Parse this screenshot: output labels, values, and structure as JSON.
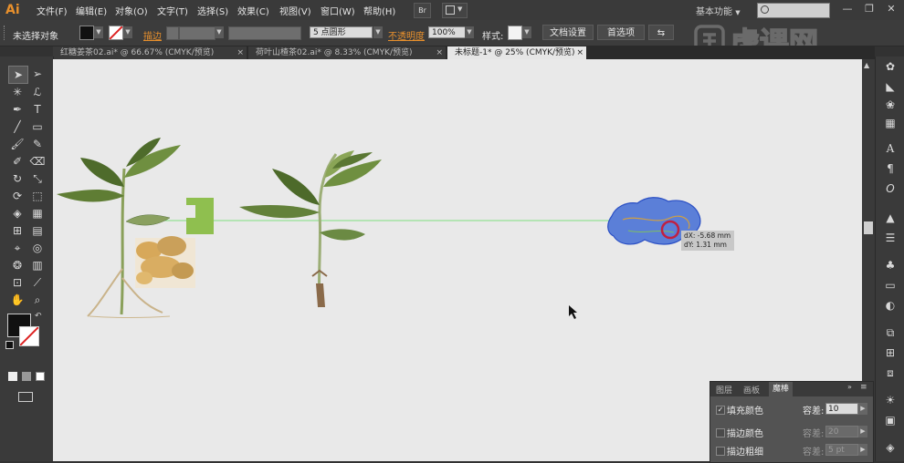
{
  "app": {
    "logo": "Ai"
  },
  "menu": {
    "items": [
      "文件(F)",
      "编辑(E)",
      "对象(O)",
      "文字(T)",
      "选择(S)",
      "效果(C)",
      "视图(V)",
      "窗口(W)",
      "帮助(H)"
    ],
    "bridge": "Br",
    "workspace": "基本功能"
  },
  "control": {
    "selection_state": "未选择对象",
    "stroke_label": "描边",
    "brush_label": "5 点圆形",
    "opacity_label": "不透明度",
    "opacity_value": "100%",
    "style_label": "样式:",
    "doc_setup_button": "文档设置",
    "preferences_button": "首选项"
  },
  "tabs": [
    {
      "label": "红糖姜茶02.ai* @ 66.67% (CMYK/预览)",
      "active": false
    },
    {
      "label": "荷叶山楂茶02.ai* @ 8.33% (CMYK/预览)",
      "active": false
    },
    {
      "label": "未标题-1* @ 25% (CMYK/预览)",
      "active": true
    }
  ],
  "tooltip": {
    "dx": "dX: -5.68 mm",
    "dy": "dY: 1.31 mm"
  },
  "magic_wand_panel": {
    "tabs": [
      "图层",
      "画板",
      "魔棒"
    ],
    "rows": [
      {
        "label": "填充颜色",
        "checked": true,
        "tolerance_label": "容差:",
        "tolerance": "10",
        "enabled": true
      },
      {
        "label": "描边颜色",
        "checked": false,
        "tolerance_label": "容差:",
        "tolerance": "20",
        "enabled": false
      },
      {
        "label": "描边粗细",
        "checked": false,
        "tolerance_label": "容差:",
        "tolerance": "5 pt",
        "enabled": false
      }
    ]
  },
  "watermark": {
    "text": "虎课网"
  },
  "colors": {
    "accent": "#e8902c",
    "canvas": "#e9e9e9",
    "guide": "#7ee07e",
    "selection_blue": "#3a5bd8"
  }
}
